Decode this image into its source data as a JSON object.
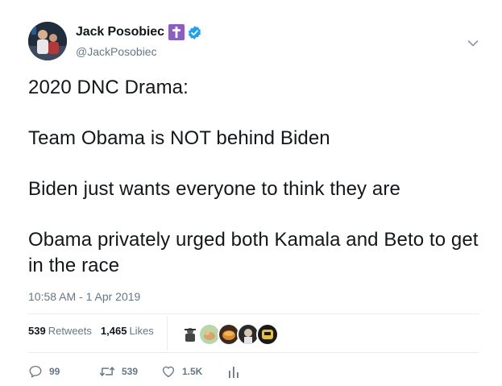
{
  "author": {
    "display_name": "Jack Posobiec",
    "handle": "@JackPosobiec",
    "badge_color": "#8e5cc9",
    "verified_color": "#1da1f2"
  },
  "tweet": {
    "lines": [
      "2020 DNC Drama:",
      "Team Obama is NOT behind Biden",
      "Biden just wants everyone to think they are",
      "Obama privately urged both Kamala and Beto to get in the race"
    ],
    "timestamp": "10:58 AM - 1 Apr 2019"
  },
  "stats": {
    "retweets_count": "539",
    "retweets_label": "Retweets",
    "likes_count": "1,465",
    "likes_label": "Likes"
  },
  "actions": {
    "reply_count": "99",
    "retweet_count": "539",
    "like_count": "1.5K"
  },
  "icons": {
    "caret": "chevron-down-icon",
    "reply": "reply-icon",
    "retweet": "retweet-icon",
    "like": "heart-icon",
    "analytics": "analytics-icon"
  },
  "colors": {
    "text": "#14171a",
    "secondary": "#657786",
    "divider": "#e6ecf0"
  }
}
